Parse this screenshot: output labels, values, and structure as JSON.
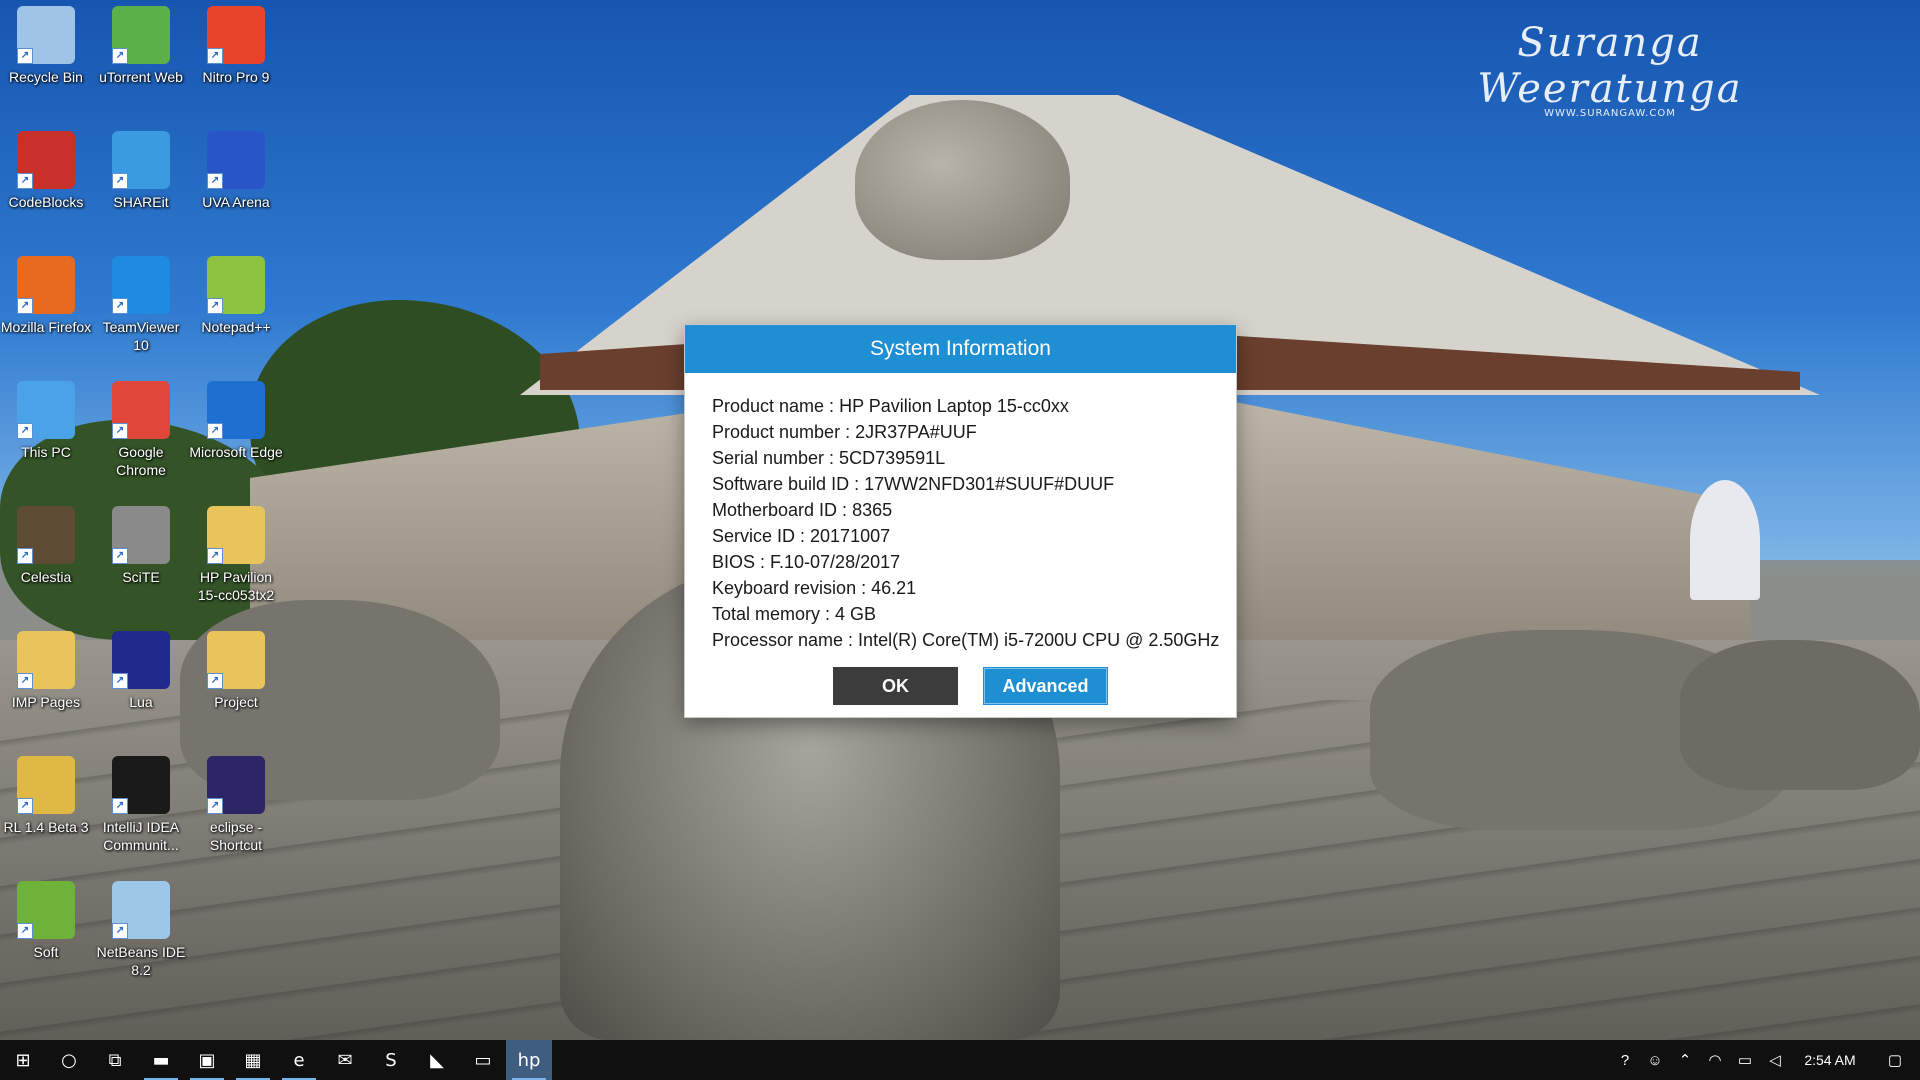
{
  "wallpaper": {
    "signature": "Suranga Weeratunga",
    "url": "WWW.SURANGAW.COM"
  },
  "desktop_icons": [
    {
      "label": "Recycle Bin",
      "icon": "recycle-bin-icon",
      "color": "#9fc4e8"
    },
    {
      "label": "uTorrent Web",
      "icon": "utorrent-icon",
      "color": "#5ab14a"
    },
    {
      "label": "Nitro Pro 9",
      "icon": "nitro-pro-icon",
      "color": "#e8442c"
    },
    {
      "label": "CodeBlocks",
      "icon": "codeblocks-icon",
      "color": "#c8302a"
    },
    {
      "label": "SHAREit",
      "icon": "shareit-icon",
      "color": "#3a9be0"
    },
    {
      "label": "UVA Arena",
      "icon": "uva-arena-icon",
      "color": "#2a55c9"
    },
    {
      "label": "Mozilla Firefox",
      "icon": "firefox-icon",
      "color": "#e86a1e"
    },
    {
      "label": "TeamViewer 10",
      "icon": "teamviewer-icon",
      "color": "#1e8be0"
    },
    {
      "label": "Notepad++",
      "icon": "notepadpp-icon",
      "color": "#8dc43f"
    },
    {
      "label": "This PC",
      "icon": "this-pc-icon",
      "color": "#4aa3e6"
    },
    {
      "label": "Google Chrome",
      "icon": "chrome-icon",
      "color": "#e0463a"
    },
    {
      "label": "Microsoft Edge",
      "icon": "edge-icon",
      "color": "#1e6fd0"
    },
    {
      "label": "Celestia",
      "icon": "celestia-icon",
      "color": "#5d4b33"
    },
    {
      "label": "SciTE",
      "icon": "scite-icon",
      "color": "#8a8a8a"
    },
    {
      "label": "HP Pavilion 15-cc053tx2",
      "icon": "folder-icon",
      "color": "#e8c45a"
    },
    {
      "label": "IMP Pages",
      "icon": "folder-icon",
      "color": "#e8c45a"
    },
    {
      "label": "Lua",
      "icon": "lua-icon",
      "color": "#1f2a8c"
    },
    {
      "label": "Project",
      "icon": "folder-icon",
      "color": "#e8c45a"
    },
    {
      "label": "RL 1.4 Beta 3",
      "icon": "zip-folder-icon",
      "color": "#e0b846"
    },
    {
      "label": "IntelliJ IDEA Communit...",
      "icon": "intellij-icon",
      "color": "#1a1a1a"
    },
    {
      "label": "eclipse - Shortcut",
      "icon": "eclipse-icon",
      "color": "#2c2566"
    },
    {
      "label": "Soft",
      "icon": "nvidia-folder-icon",
      "color": "#6fb23a"
    },
    {
      "label": "NetBeans IDE 8.2",
      "icon": "netbeans-icon",
      "color": "#9cc7e8"
    }
  ],
  "dialog": {
    "title": "System Information",
    "lines": [
      "Product name : HP Pavilion Laptop 15-cc0xx",
      "Product number : 2JR37PA#UUF",
      "Serial number : 5CD739591L",
      "Software build ID : 17WW2NFD301#SUUF#DUUF",
      "Motherboard ID : 8365",
      "Service ID : 20171007",
      "BIOS : F.10-07/28/2017",
      "Keyboard revision : 46.21",
      "Total memory : 4 GB",
      "Processor name : Intel(R) Core(TM) i5-7200U CPU @ 2.50GHz"
    ],
    "ok_label": "OK",
    "advanced_label": "Advanced"
  },
  "taskbar": {
    "items": [
      {
        "name": "start-button",
        "glyph": "⊞"
      },
      {
        "name": "cortana-button",
        "glyph": "○"
      },
      {
        "name": "task-view-button",
        "glyph": "⧉"
      },
      {
        "name": "file-explorer-button",
        "glyph": "▬"
      },
      {
        "name": "store-button",
        "glyph": "▣"
      },
      {
        "name": "app-green-button",
        "glyph": "▦"
      },
      {
        "name": "edge-button",
        "glyph": "e"
      },
      {
        "name": "mail-button",
        "glyph": "✉"
      },
      {
        "name": "sublime-button",
        "glyph": "S"
      },
      {
        "name": "app-blue-button",
        "glyph": "◣"
      },
      {
        "name": "app-window-button",
        "glyph": "▭"
      },
      {
        "name": "hp-support-button",
        "glyph": "hp"
      }
    ],
    "time": "2:54 AM"
  }
}
